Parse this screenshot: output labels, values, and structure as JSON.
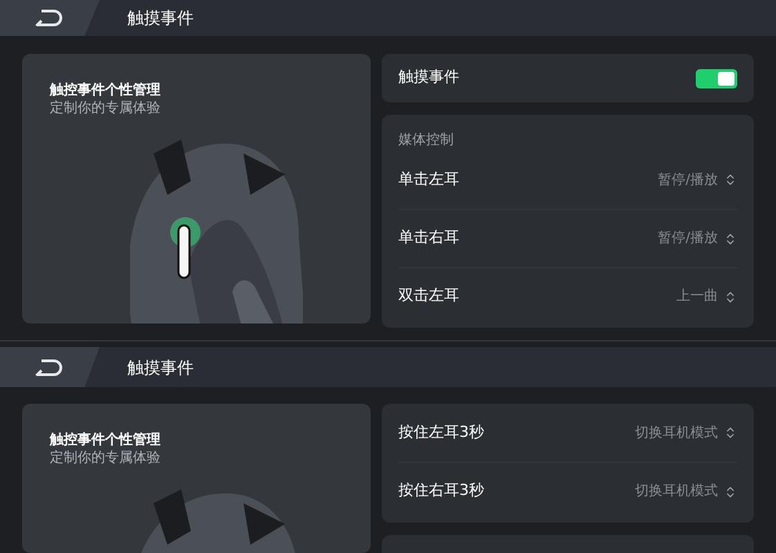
{
  "screens": [
    {
      "header": {
        "title": "触摸事件"
      },
      "banner": {
        "title": "触控事件个性管理",
        "subtitle": "定制你的专属体验"
      },
      "cards": [
        {
          "kind": "toggle",
          "label": "触摸事件",
          "on": true
        },
        {
          "kind": "list",
          "heading": "媒体控制",
          "rows": [
            {
              "label": "单击左耳",
              "value": "暂停/播放"
            },
            {
              "label": "单击右耳",
              "value": "暂停/播放"
            },
            {
              "label": "双击左耳",
              "value": "上一曲"
            }
          ]
        }
      ]
    },
    {
      "header": {
        "title": "触摸事件"
      },
      "banner": {
        "title": "触控事件个性管理",
        "subtitle": "定制你的专属体验"
      },
      "cards": [
        {
          "kind": "list",
          "rows": [
            {
              "label": "按住左耳3秒",
              "value": "切换耳机模式"
            },
            {
              "label": "按住右耳3秒",
              "value": "切换耳机模式"
            }
          ]
        },
        {
          "kind": "blank"
        }
      ]
    }
  ]
}
